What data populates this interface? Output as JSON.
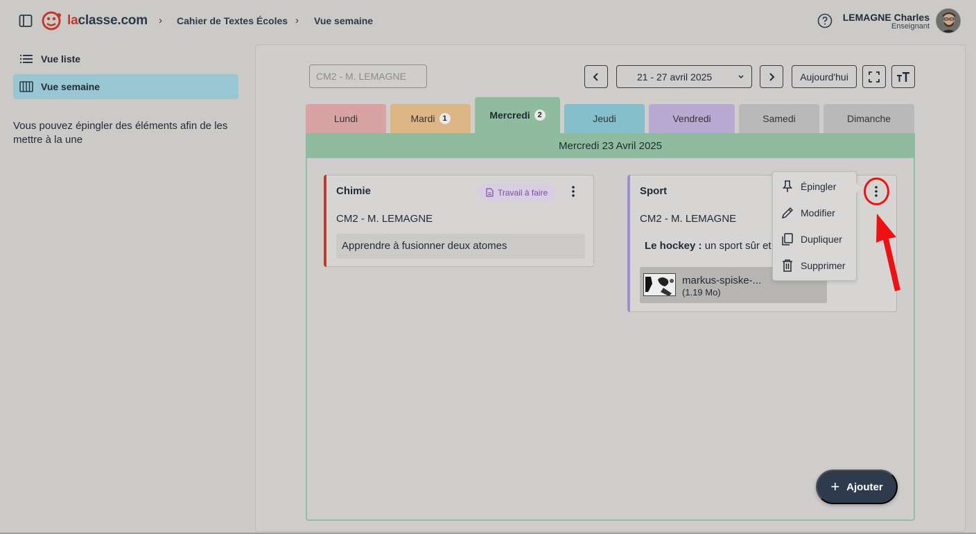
{
  "header": {
    "logo_prefix": "la",
    "logo_rest": "classe.com",
    "breadcrumbs": [
      "Cahier de Textes Écoles",
      "Vue semaine"
    ],
    "user_name": "LEMAGNE Charles",
    "user_role": "Enseignant"
  },
  "sidebar": {
    "items": [
      {
        "label": "Vue liste",
        "icon": "list-icon",
        "active": false
      },
      {
        "label": "Vue semaine",
        "icon": "week-columns-icon",
        "active": true
      }
    ],
    "note": "Vous pouvez épingler des éléments afin de les mettre à la une"
  },
  "toolbar": {
    "class_placeholder": "CM2 - M. LEMAGNE",
    "week_range": "21 - 27 avril 2025",
    "today_label": "Aujourd'hui"
  },
  "tabs": [
    {
      "label": "Lundi",
      "badge": "",
      "color": "#d9a3a3"
    },
    {
      "label": "Mardi",
      "badge": "1",
      "color": "#ddb685"
    },
    {
      "label": "Mercredi",
      "badge": "2",
      "color": "#8fbc9f",
      "active": true
    },
    {
      "label": "Jeudi",
      "badge": "",
      "color": "#85bfcc"
    },
    {
      "label": "Vendredi",
      "badge": "",
      "color": "#b8aad2"
    },
    {
      "label": "Samedi",
      "badge": "",
      "color": "#bab9b9"
    },
    {
      "label": "Dimanche",
      "badge": "",
      "color": "#bab9b9"
    }
  ],
  "day_header": "Mercredi 23 Avril 2025",
  "cards": [
    {
      "title": "Chimie",
      "class": "CM2 - M. LEMAGNE",
      "chip": "Travail à faire",
      "body": "Apprendre à fusionner deux atomes",
      "accent": "#c0392b"
    },
    {
      "title": "Sport",
      "class": "CM2 - M. LEMAGNE",
      "body_bold": "Le hockey :",
      "body": " un sport sûr et",
      "accent": "#9d8fd4",
      "attachment": {
        "name": "markus-spiske-...",
        "size": "(1.19 Mo)"
      }
    }
  ],
  "context_menu": {
    "items": [
      {
        "label": "Épingler",
        "icon": "pin-icon"
      },
      {
        "label": "Modifier",
        "icon": "pencil-icon"
      },
      {
        "label": "Dupliquer",
        "icon": "copy-icon"
      },
      {
        "label": "Supprimer",
        "icon": "trash-icon"
      }
    ]
  },
  "fab_label": "Ajouter",
  "annotation_color": "#ee1111"
}
